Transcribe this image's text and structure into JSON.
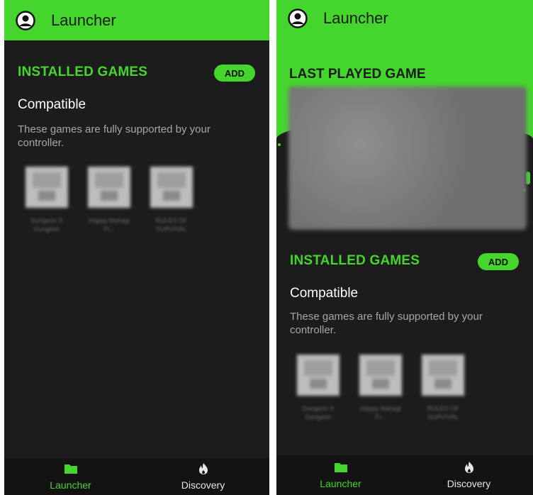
{
  "colors": {
    "accent": "#44d62c",
    "background": "#1c1c1c",
    "nav_background": "#131313"
  },
  "left_screen": {
    "header": {
      "title": "Launcher",
      "avatar_icon": "user-circle-icon"
    },
    "installed": {
      "title": "INSTALLED GAMES",
      "add_label": "ADD",
      "subhead": "Compatible",
      "description": "These games are fully supported by your controller.",
      "games": [
        {
          "name": "Dungeon X Dungeon"
        },
        {
          "name": "Happy Mahagi Fr..."
        },
        {
          "name": "RULES OF SURVIVAL"
        }
      ]
    },
    "nav": {
      "items": [
        {
          "label": "Launcher",
          "icon": "folder-icon"
        },
        {
          "label": "Discovery",
          "icon": "flame-icon"
        }
      ]
    }
  },
  "right_screen": {
    "header": {
      "title": "Launcher",
      "avatar_icon": "user-circle-icon"
    },
    "last_played": {
      "title": "LAST PLAYED GAME"
    },
    "installed": {
      "title": "INSTALLED GAMES",
      "add_label": "ADD",
      "subhead": "Compatible",
      "description": "These games are fully supported by your controller.",
      "games": [
        {
          "name": "Dungeon X Dungeon"
        },
        {
          "name": "Happy Mahagi Fr..."
        },
        {
          "name": "RULES OF SURVIVAL"
        }
      ]
    },
    "nav": {
      "items": [
        {
          "label": "Launcher",
          "icon": "folder-icon"
        },
        {
          "label": "Discovery",
          "icon": "flame-icon"
        }
      ]
    }
  }
}
